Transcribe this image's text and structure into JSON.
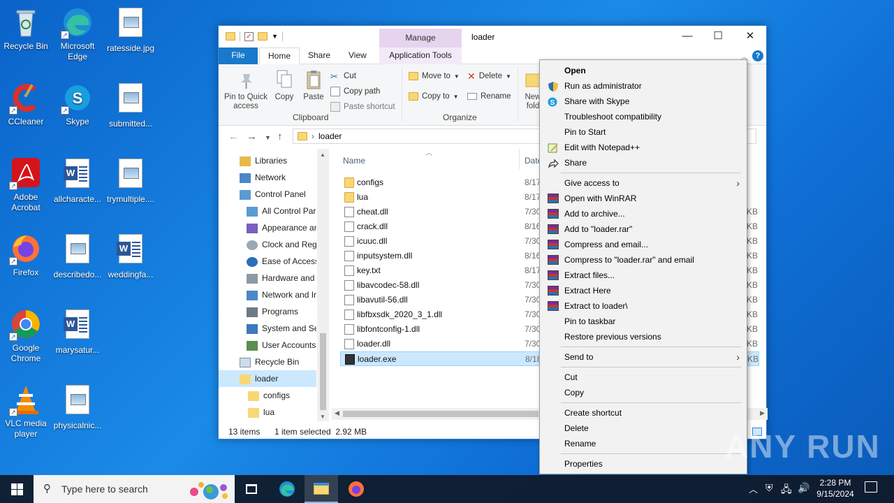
{
  "desktop": {
    "icons": [
      {
        "label": "Recycle Bin"
      },
      {
        "label": "Microsoft Edge"
      },
      {
        "label": "ratesside.jpg"
      },
      {
        "label": "CCleaner"
      },
      {
        "label": "Skype"
      },
      {
        "label": "submitted..."
      },
      {
        "label": "Adobe Acrobat"
      },
      {
        "label": "allcharacte..."
      },
      {
        "label": "trymultiple...."
      },
      {
        "label": "Firefox"
      },
      {
        "label": "describedo..."
      },
      {
        "label": "weddingfa..."
      },
      {
        "label": "Google Chrome"
      },
      {
        "label": "marysatur..."
      },
      {
        "label": "VLC media player"
      },
      {
        "label": "physicalnic..."
      }
    ]
  },
  "explorer": {
    "title": "loader",
    "context_tab": "Manage",
    "tabs": {
      "file": "File",
      "home": "Home",
      "share": "Share",
      "view": "View",
      "apptools": "Application Tools"
    },
    "help": "?",
    "ribbon": {
      "pin": "Pin to Quick access",
      "copy": "Copy",
      "paste": "Paste",
      "cut": "Cut",
      "copy_path": "Copy path",
      "paste_shortcut": "Paste shortcut",
      "clipboard_label": "Clipboard",
      "move_to": "Move to",
      "copy_to": "Copy to",
      "delete": "Delete",
      "rename": "Rename",
      "organize_label": "Organize",
      "new_folder": "New fold"
    },
    "address": {
      "path": "loader"
    },
    "nav": [
      {
        "label": "Libraries"
      },
      {
        "label": "Network"
      },
      {
        "label": "Control Panel"
      },
      {
        "label": "All Control Par"
      },
      {
        "label": "Appearance an"
      },
      {
        "label": "Clock and Regi"
      },
      {
        "label": "Ease of Access"
      },
      {
        "label": "Hardware and"
      },
      {
        "label": "Network and Ir"
      },
      {
        "label": "Programs"
      },
      {
        "label": "System and Se"
      },
      {
        "label": "User Accounts"
      },
      {
        "label": "Recycle Bin"
      },
      {
        "label": "loader"
      },
      {
        "label": "configs"
      },
      {
        "label": "lua"
      }
    ],
    "columns": {
      "name": "Name",
      "date": "Date"
    },
    "files": [
      {
        "name": "configs",
        "date": "8/17",
        "size": ""
      },
      {
        "name": "lua",
        "date": "8/17",
        "size": ""
      },
      {
        "name": "cheat.dll",
        "date": "7/30",
        "size": "KB"
      },
      {
        "name": "crack.dll",
        "date": "8/16",
        "size": "KB"
      },
      {
        "name": "icuuc.dll",
        "date": "7/30",
        "size": "KB"
      },
      {
        "name": "inputsystem.dll",
        "date": "8/16",
        "size": "KB"
      },
      {
        "name": "key.txt",
        "date": "8/17",
        "size": "KB"
      },
      {
        "name": "libavcodec-58.dll",
        "date": "7/30",
        "size": "KB"
      },
      {
        "name": "libavutil-56.dll",
        "date": "7/30",
        "size": "KB"
      },
      {
        "name": "libfbxsdk_2020_3_1.dll",
        "date": "7/30",
        "size": "KB"
      },
      {
        "name": "libfontconfig-1.dll",
        "date": "7/30",
        "size": "KB"
      },
      {
        "name": "loader.dll",
        "date": "7/30",
        "size": "KB"
      },
      {
        "name": "loader.exe",
        "date": "8/18",
        "size": "KB"
      }
    ],
    "status": {
      "items": "13 items",
      "selected": "1 item selected  2.92 MB"
    }
  },
  "context_menu": {
    "items": [
      {
        "label": "Open"
      },
      {
        "label": "Run as administrator"
      },
      {
        "label": "Share with Skype"
      },
      {
        "label": "Troubleshoot compatibility"
      },
      {
        "label": "Pin to Start"
      },
      {
        "label": "Edit with Notepad++"
      },
      {
        "label": "Share"
      },
      {
        "label": "Give access to"
      },
      {
        "label": "Open with WinRAR"
      },
      {
        "label": "Add to archive..."
      },
      {
        "label": "Add to \"loader.rar\""
      },
      {
        "label": "Compress and email..."
      },
      {
        "label": "Compress to \"loader.rar\" and email"
      },
      {
        "label": "Extract files..."
      },
      {
        "label": "Extract Here"
      },
      {
        "label": "Extract to loader\\"
      },
      {
        "label": "Pin to taskbar"
      },
      {
        "label": "Restore previous versions"
      },
      {
        "label": "Send to"
      },
      {
        "label": "Cut"
      },
      {
        "label": "Copy"
      },
      {
        "label": "Create shortcut"
      },
      {
        "label": "Delete"
      },
      {
        "label": "Rename"
      },
      {
        "label": "Properties"
      }
    ]
  },
  "watermark": "ANY RUN",
  "taskbar": {
    "search_placeholder": "Type here to search",
    "time": "2:28 PM",
    "date": "9/15/2024"
  },
  "colors": {
    "accent": "#1979ca",
    "selection": "#cce8ff",
    "desktop": "#0f6fd6"
  }
}
